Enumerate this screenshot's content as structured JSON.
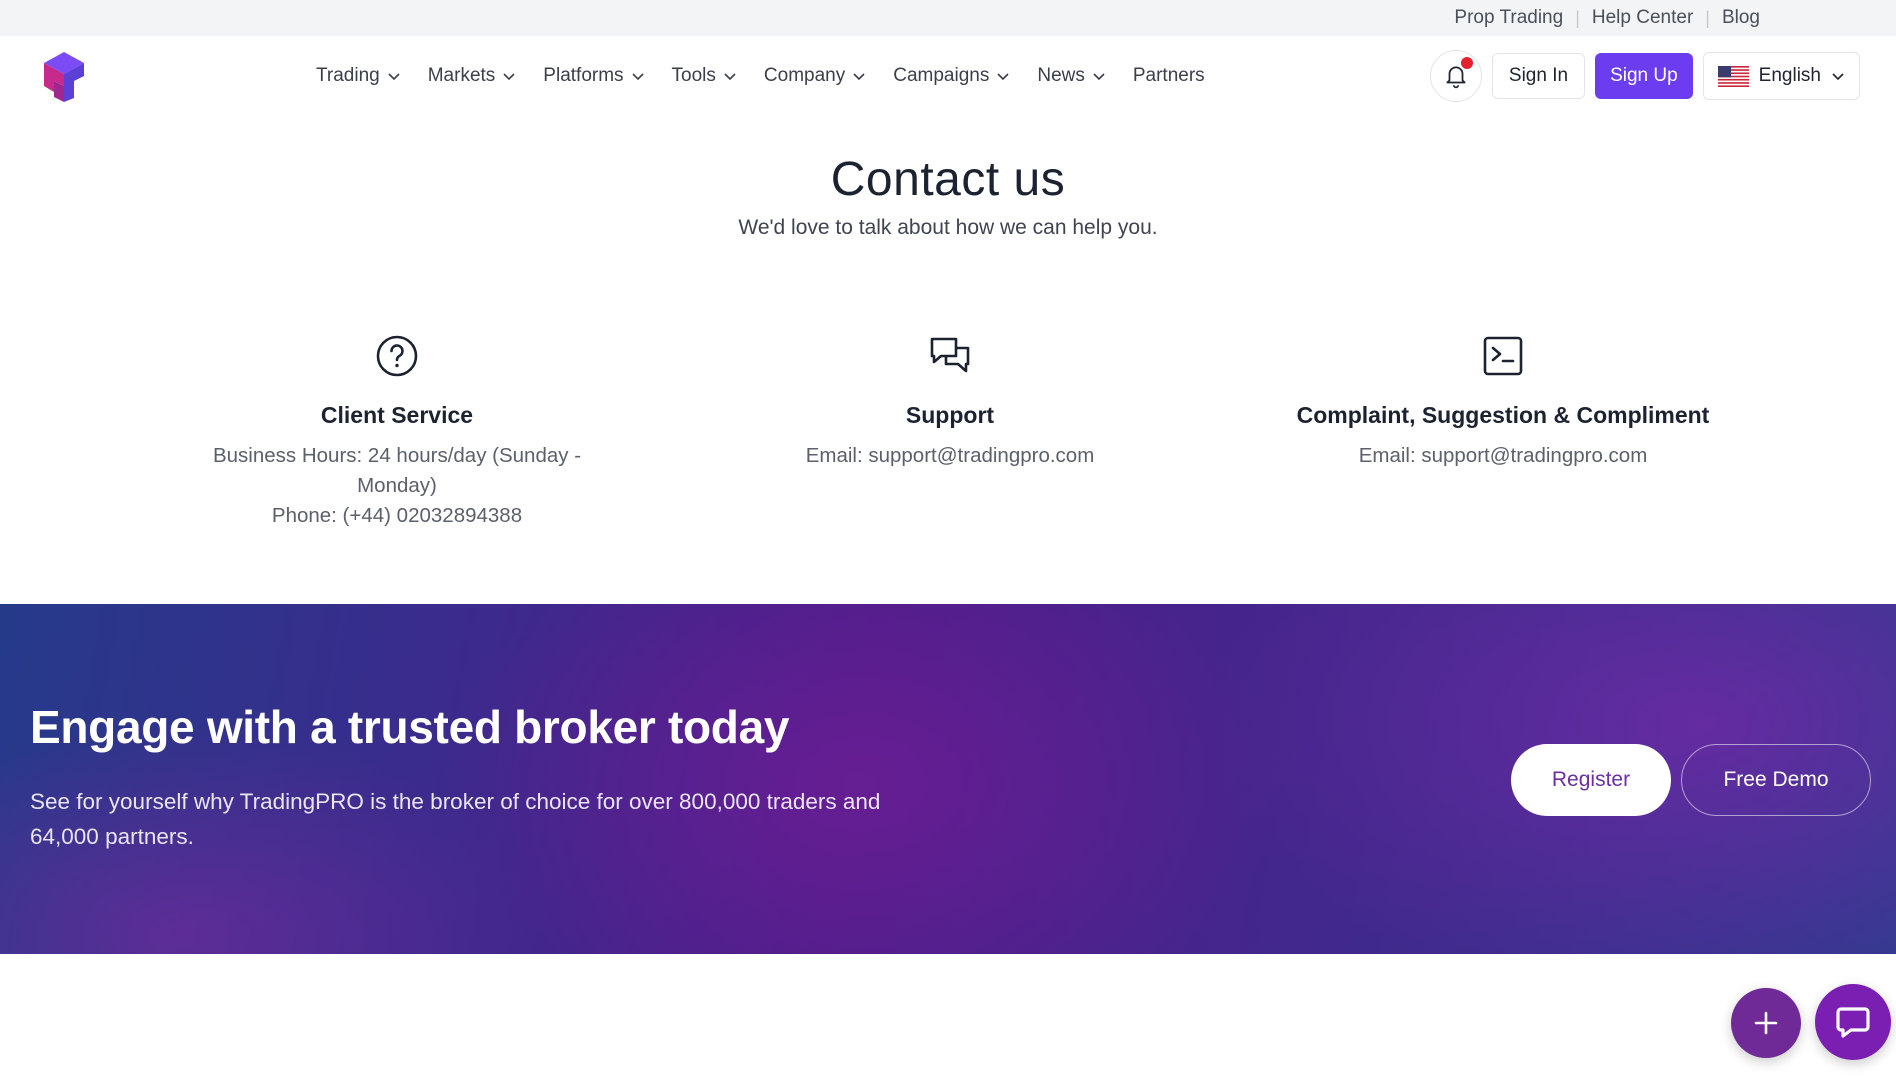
{
  "topbar": {
    "links": [
      "Prop Trading",
      "Help Center",
      "Blog"
    ]
  },
  "header": {
    "logo_icon": "tradingpro-logo-icon",
    "nav": [
      {
        "label": "Trading",
        "has_dropdown": true
      },
      {
        "label": "Markets",
        "has_dropdown": true
      },
      {
        "label": "Platforms",
        "has_dropdown": true
      },
      {
        "label": "Tools",
        "has_dropdown": true
      },
      {
        "label": "Company",
        "has_dropdown": true
      },
      {
        "label": "Campaigns",
        "has_dropdown": true
      },
      {
        "label": "News",
        "has_dropdown": true
      },
      {
        "label": "Partners",
        "has_dropdown": false
      }
    ],
    "notification_icon": "bell-icon",
    "signin_label": "Sign In",
    "signup_label": "Sign Up",
    "language": "English",
    "language_flag": "us-flag-icon"
  },
  "contact": {
    "title": "Contact us",
    "subtitle": "We'd love to talk about how we can help you.",
    "columns": [
      {
        "icon": "question-circle-icon",
        "title": "Client Service",
        "lines": [
          "Business Hours: 24 hours/day (Sunday - Monday)",
          "Phone: (+44) 02032894388"
        ]
      },
      {
        "icon": "chat-bubbles-icon",
        "title": "Support",
        "lines": [
          "Email: support@tradingpro.com"
        ]
      },
      {
        "icon": "terminal-square-icon",
        "title": "Complaint, Suggestion & Compliment",
        "lines": [
          "Email: support@tradingpro.com"
        ]
      }
    ]
  },
  "cta": {
    "title": "Engage with a trusted broker today",
    "subtitle": "See for yourself why TradingPRO is the broker of choice for over 800,000 traders and 64,000 partners.",
    "register_label": "Register",
    "demo_label": "Free Demo"
  },
  "floating": {
    "plus_icon": "plus-icon",
    "chat_icon": "chat-icon"
  },
  "colors": {
    "accent": "#6c3cf0",
    "notification_dot": "#e5212e",
    "fab_plus": "#6f2a98",
    "fab_chat": "#7a1fb2"
  }
}
